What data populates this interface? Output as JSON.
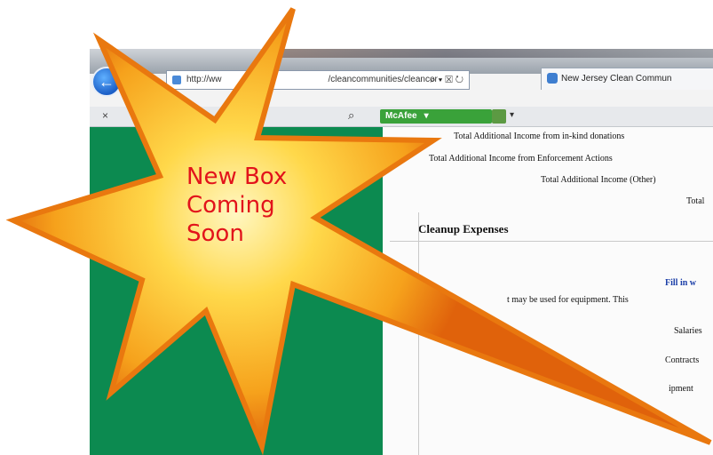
{
  "browser": {
    "back_icon": "back-arrow-icon",
    "address_text": "http://ww",
    "address_text_2": "/cleancommunities/cleancor",
    "address_controls": "⌕ ▾ ☒ ↻",
    "tab_title": "New Jersey Clean Commun",
    "toolbar_close": "×",
    "toolbar_search_icon": "⌕",
    "mcafee_label": "McAfee",
    "mcafee_dropdown": "▾",
    "toolbar_caret": "▾"
  },
  "content": {
    "lines": [
      "Total Additional Income from in-kind donations",
      "Total Additional Income from Enforcement Actions",
      "Total Additional Income (Other)",
      "Total"
    ],
    "section_heading": "Cleanup Expenses",
    "fill_label": "Fill in w",
    "note_text": "t may be used for equipment. This",
    "rows": [
      "Salaries",
      "Contracts",
      "ipment"
    ]
  },
  "promo": {
    "line1": "New Box",
    "line2": "Coming",
    "line3": "Soon",
    "star_gradient": [
      "#fff7c2",
      "#ffd84a",
      "#f6a21c",
      "#e0620b"
    ],
    "text_color": "#e2131b"
  }
}
